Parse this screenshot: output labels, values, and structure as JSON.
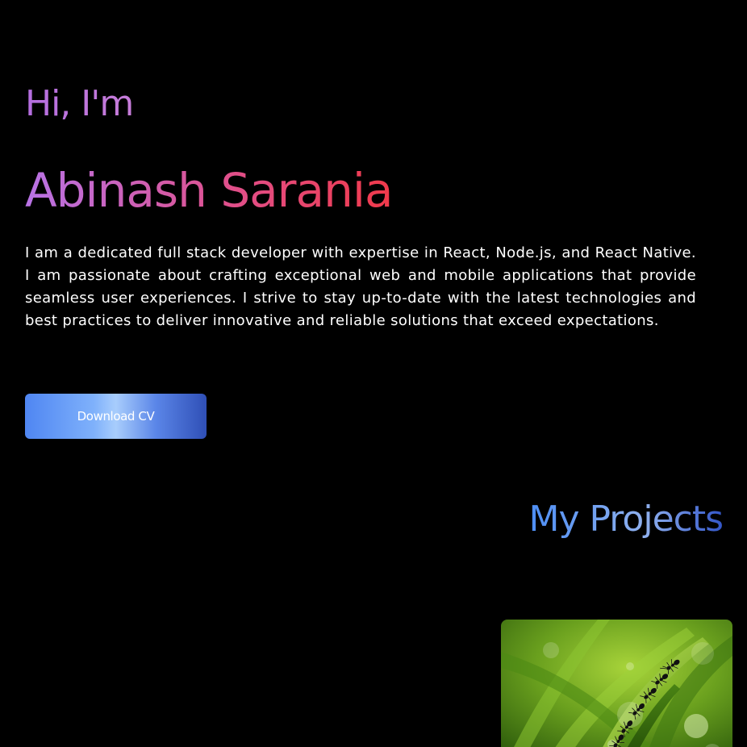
{
  "hero": {
    "greeting": "Hi, I'm",
    "name": "Abinash Sarania",
    "bio": "I am a dedicated full stack developer with expertise in React, Node.js, and React Native. I am passionate about crafting exceptional web and mobile applications that provide seamless user experiences. I strive to stay up-to-date with the latest technologies and best practices to deliver innovative and reliable solutions that exceed expectations.",
    "download_cv_label": "Download CV"
  },
  "projects": {
    "title": "My Projects"
  },
  "colors": {
    "background": "#000000",
    "greeting_purple": "#b56ee0",
    "name_gradient_start": "#b873e6",
    "name_gradient_end": "#f0394a",
    "button_blue": "#4f86f2",
    "projects_title_blue": "#4d8ef5"
  }
}
